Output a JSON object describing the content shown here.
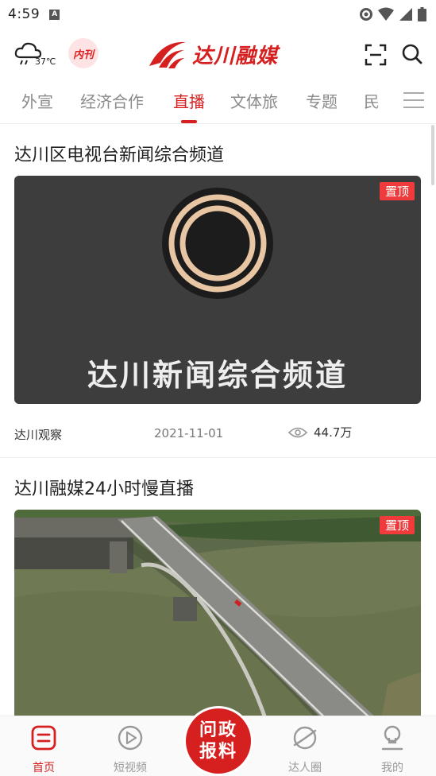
{
  "status_bar": {
    "time": "4:59",
    "notification_icon": "A"
  },
  "header": {
    "weather_temp": "37℃",
    "neikan_label": "内刊",
    "brand_name": "达川融媒",
    "brand_color": "#d61f1f"
  },
  "tabs": [
    {
      "label": "外宣",
      "active": false
    },
    {
      "label": "经济合作",
      "active": false
    },
    {
      "label": "直播",
      "active": true
    },
    {
      "label": "文体旅",
      "active": false
    },
    {
      "label": "专题",
      "active": false
    },
    {
      "label": "民",
      "active": false
    }
  ],
  "feed": [
    {
      "title": "达川区电视台新闻综合频道",
      "badge": "置顶",
      "video_caption": "达川新闻综合频道",
      "source": "达川观察",
      "date": "2021-11-01",
      "views": "44.7万"
    },
    {
      "title": "达川融媒24小时慢直播",
      "badge": "置顶"
    }
  ],
  "bottom_nav": {
    "items": [
      {
        "label": "首页",
        "icon": "home-icon",
        "active": true
      },
      {
        "label": "短视频",
        "icon": "play-circle-icon",
        "active": false
      },
      {
        "label": "达人圈",
        "icon": "planet-icon",
        "active": false
      },
      {
        "label": "我的",
        "icon": "profile-icon",
        "active": false
      }
    ],
    "center_button": "问政报料"
  }
}
